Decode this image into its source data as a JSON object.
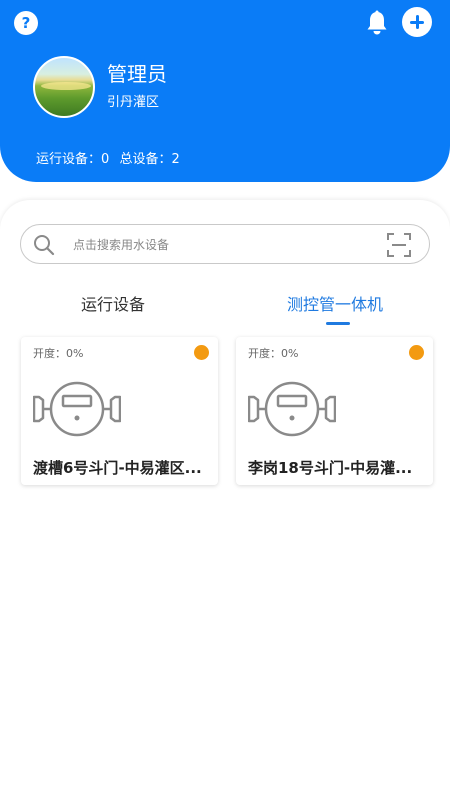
{
  "header": {
    "user_name": "管理员",
    "area_name": "引丹灌区",
    "running_label": "运行设备：",
    "running_count": "0",
    "total_label": "总设备：",
    "total_count": "2"
  },
  "icons": {
    "help": "?",
    "notification": "bell-icon",
    "add": "plus-icon",
    "search": "magnifier-icon",
    "scan": "scan-frame-icon",
    "device": "water-meter-icon"
  },
  "search": {
    "placeholder": "点击搜索用水设备",
    "value": ""
  },
  "tabs": [
    {
      "label": "运行设备",
      "active": false
    },
    {
      "label": "测控管一体机",
      "active": true
    }
  ],
  "devices": [
    {
      "open_label": "开度：",
      "open_value": "0%",
      "title": "渡槽6号斗门-中易灌区...",
      "status_color": "#f39a11"
    },
    {
      "open_label": "开度：",
      "open_value": "0%",
      "title": "李岗18号斗门-中易灌...",
      "status_color": "#f39a11"
    }
  ],
  "colors": {
    "primary": "#0a7cf7",
    "active_tab": "#1f7ae0",
    "status_orange": "#f39a11",
    "icon_gray": "#8a8a8a"
  }
}
